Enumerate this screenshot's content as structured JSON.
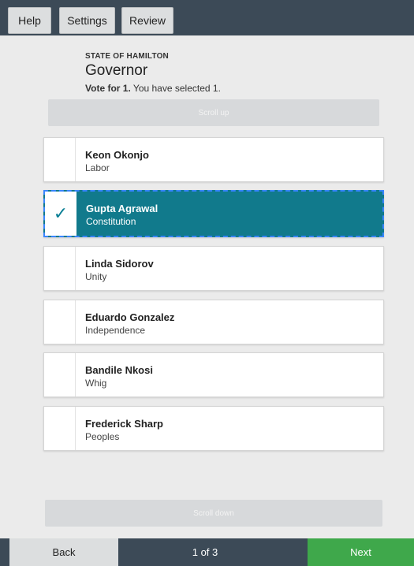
{
  "topbar": {
    "help_label": "Help",
    "settings_label": "Settings",
    "review_label": "Review"
  },
  "contest": {
    "state": "STATE OF HAMILTON",
    "office": "Governor",
    "vote_for": "Vote for 1.",
    "selected_text": "You have selected 1."
  },
  "scroll": {
    "up_label": "Scroll up",
    "down_label": "Scroll down"
  },
  "candidates": [
    {
      "name": "Keon Okonjo",
      "party": "Labor",
      "selected": false
    },
    {
      "name": "Gupta Agrawal",
      "party": "Constitution",
      "selected": true
    },
    {
      "name": "Linda Sidorov",
      "party": "Unity",
      "selected": false
    },
    {
      "name": "Eduardo Gonzalez",
      "party": "Independence",
      "selected": false
    },
    {
      "name": "Bandile Nkosi",
      "party": "Whig",
      "selected": false
    },
    {
      "name": "Frederick Sharp",
      "party": "Peoples",
      "selected": false
    }
  ],
  "check_glyph": "✓",
  "bottombar": {
    "back_label": "Back",
    "page_indicator": "1 of 3",
    "next_label": "Next"
  },
  "colors": {
    "topbar": "#3c4a57",
    "selected": "#117a8c",
    "next": "#3fa84b"
  }
}
